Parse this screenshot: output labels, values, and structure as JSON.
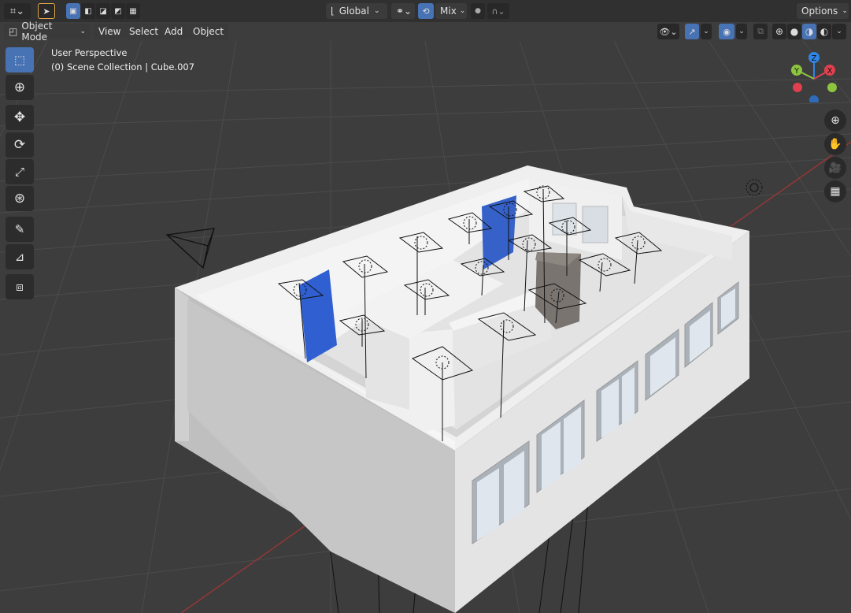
{
  "header": {
    "transform_orientation": "Global",
    "proportional_falloff": "Mix",
    "options_label": "Options"
  },
  "viewport_header": {
    "mode_label": "Object Mode",
    "menus": [
      "View",
      "Select",
      "Add",
      "Object"
    ]
  },
  "viewport_info": {
    "view_name": "User Perspective",
    "context": "(0) Scene Collection | Cube.007"
  },
  "gizmo": {
    "axes": [
      "X",
      "Y",
      "Z"
    ],
    "colors": {
      "x": "#e0404e",
      "y": "#8cc63f",
      "z": "#2f86e8"
    }
  },
  "toolbar": {
    "tools": [
      "select-box",
      "cursor",
      "move",
      "rotate",
      "scale",
      "transform",
      "annotate",
      "measure",
      "add-cube"
    ]
  },
  "navigation": {
    "buttons": [
      "zoom",
      "pan",
      "camera",
      "perspective-toggle"
    ]
  },
  "colors": {
    "accent": "#4772b3",
    "door": "#2f5fd0",
    "grid_x_axis": "#a33a3a"
  }
}
